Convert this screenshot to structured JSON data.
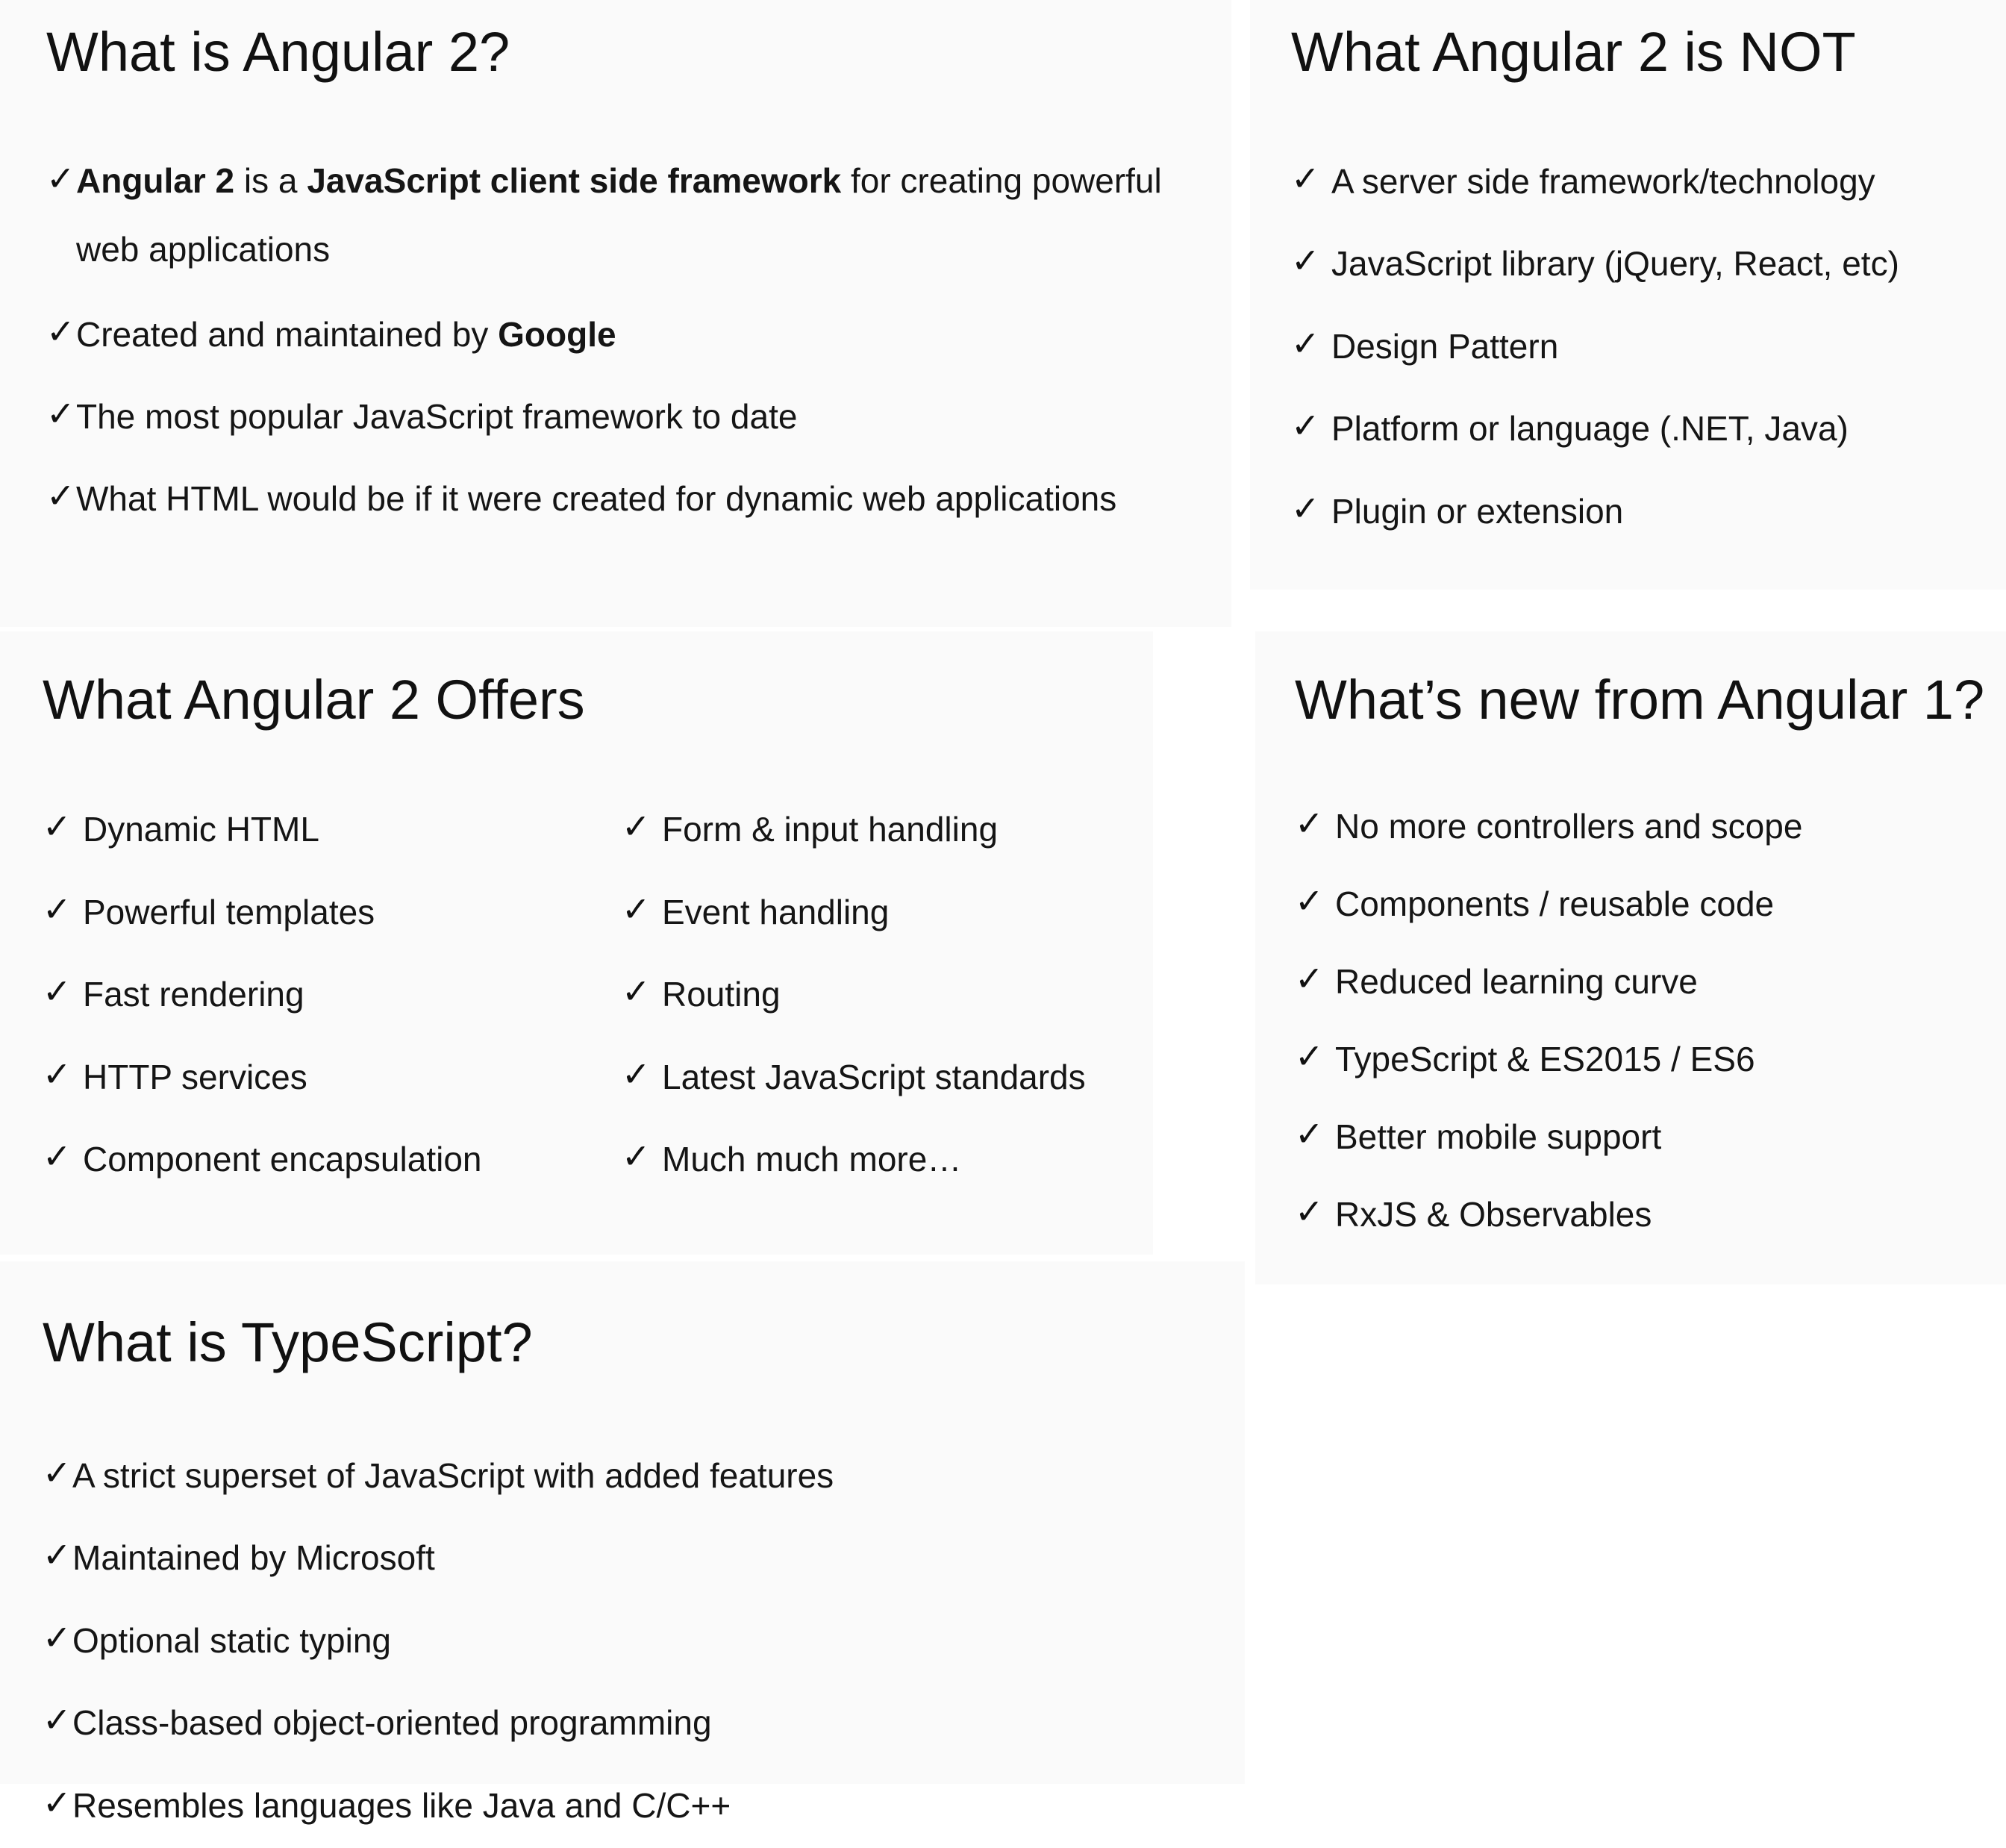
{
  "check_glyph": "✓",
  "panels": {
    "what_is_angular": {
      "title": "What is Angular 2?",
      "items": [
        {
          "b1": "Angular 2",
          "t1": " is a ",
          "b2": "JavaScript client side framework",
          "t2": " for creating powerful web applications"
        },
        {
          "t1": "Created and maintained by ",
          "b1": "Google"
        },
        {
          "text": "The most popular JavaScript framework to date"
        },
        {
          "text": "What HTML would be if it were created for dynamic web applications"
        }
      ]
    },
    "angular_is_not": {
      "title": "What Angular 2 is NOT",
      "items": [
        "A server side framework/technology",
        "JavaScript library (jQuery, React, etc)",
        "Design Pattern",
        "Platform or language (.NET, Java)",
        "Plugin or extension"
      ]
    },
    "angular_offers": {
      "title": "What Angular 2 Offers",
      "left_items": [
        "Dynamic HTML",
        "Powerful templates",
        "Fast rendering",
        "HTTP services",
        "Component encapsulation"
      ],
      "right_items": [
        "Form & input handling",
        "Event handling",
        "Routing",
        "Latest JavaScript standards",
        "Much much more…"
      ]
    },
    "whats_new": {
      "title": "What’s new from Angular 1?",
      "items": [
        "No more controllers and scope",
        "Components / reusable code",
        "Reduced learning curve",
        "TypeScript & ES2015 / ES6",
        "Better mobile support",
        "RxJS & Observables"
      ]
    },
    "what_is_typescript": {
      "title": "What is TypeScript?",
      "items": [
        "A strict superset of JavaScript with added features",
        "Maintained by Microsoft",
        "Optional static typing",
        "Class-based object-oriented programming",
        "Resembles languages like Java and C/C++"
      ]
    }
  }
}
